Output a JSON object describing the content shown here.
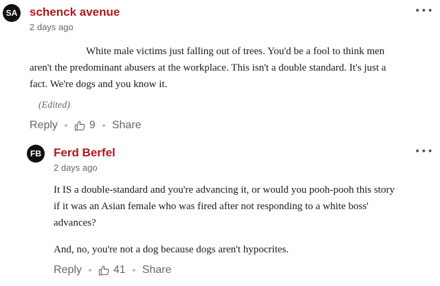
{
  "comment1": {
    "avatar_initials": "SA",
    "author": "schenck avenue",
    "time": "2 days ago",
    "more_label": "•••",
    "body_line1": "White male victims just falling out of trees.  You'd be a fool to think men",
    "body_line2": "aren't the predominant abusers at the workplace.  This isn't a double standard.  It's just a",
    "body_line3": "fact.  We're dogs and you know it.",
    "edited_label": "(Edited)",
    "reply_label": "Reply",
    "like_count": "9",
    "share_label": "Share"
  },
  "comment2": {
    "avatar_initials": "FB",
    "author": "Ferd Berfel",
    "time": "2 days ago",
    "more_label": "•••",
    "body_line1": "It IS a double-standard and you're advancing it, or would you pooh-pooh this story",
    "body_line2": "if it was an Asian female who was fired after not responding to a white boss'",
    "body_line3": "advances?",
    "body_para2": "And, no, you're not a dog because dogs aren't hypocrites.",
    "reply_label": "Reply",
    "like_count": "41",
    "share_label": "Share"
  },
  "colors": {
    "author": "#b0161c",
    "avatar_bg": "#111111",
    "muted": "#666666"
  },
  "icons": {
    "like": "thumbs-up-outline-icon",
    "more": "ellipsis-icon"
  }
}
